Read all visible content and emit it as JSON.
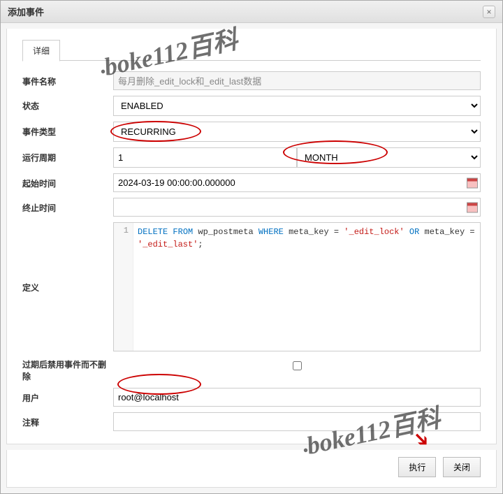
{
  "dialog": {
    "title": "添加事件",
    "close_icon": "×"
  },
  "tabs": {
    "detail": "详细"
  },
  "form": {
    "labels": {
      "event_name": "事件名称",
      "status": "状态",
      "event_type": "事件类型",
      "run_period": "运行周期",
      "start_time": "起始时间",
      "end_time": "终止时间",
      "definition": "定义",
      "expire_disable": "过期后禁用事件而不删除",
      "user": "用户",
      "comment": "注释"
    },
    "values": {
      "event_name": "每月删除_edit_lock和_edit_last数据",
      "status": "ENABLED",
      "event_type": "RECURRING",
      "period_num": "1",
      "period_unit": "MONTH",
      "start_time": "2024-03-19 00:00:00.000000",
      "end_time": "",
      "user": "root@localhost",
      "comment": ""
    },
    "sql": {
      "line_no": "1",
      "kw_delete": "DELETE",
      "kw_from": "FROM",
      "tbl": " wp_postmeta ",
      "kw_where": "WHERE",
      "col1": " meta_key = ",
      "str1": "'_edit_lock'",
      "kw_or": " OR ",
      "col2": "meta_key = ",
      "str2": "'_edit_last'",
      "semi": ";"
    }
  },
  "buttons": {
    "execute": "执行",
    "close": "关闭"
  },
  "watermark": "boke112百科"
}
